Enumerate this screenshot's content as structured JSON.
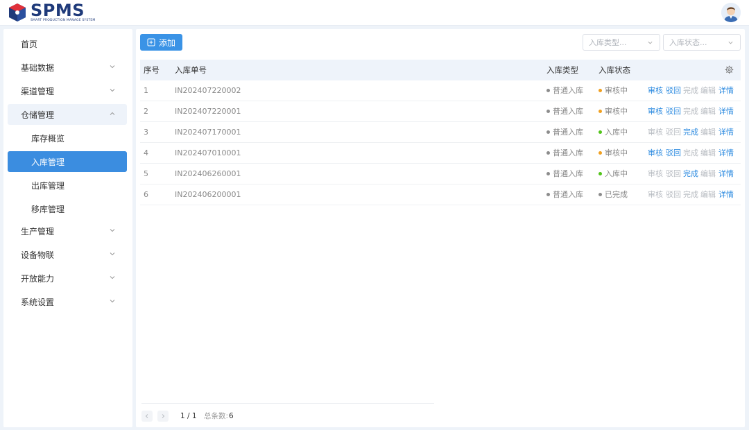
{
  "app": {
    "logo_title": "SPMS",
    "logo_subtitle": "SMART PRODUCTION MANAGE SYSTEM"
  },
  "sidebar": {
    "items": [
      {
        "label": "首页"
      },
      {
        "label": "基础数据"
      },
      {
        "label": "渠道管理"
      },
      {
        "label": "仓储管理"
      },
      {
        "label": "库存概览"
      },
      {
        "label": "入库管理"
      },
      {
        "label": "出库管理"
      },
      {
        "label": "移库管理"
      },
      {
        "label": "生产管理"
      },
      {
        "label": "设备物联"
      },
      {
        "label": "开放能力"
      },
      {
        "label": "系统设置"
      }
    ]
  },
  "toolbar": {
    "add_label": "添加",
    "filter_type_placeholder": "入库类型...",
    "filter_status_placeholder": "入库状态..."
  },
  "table": {
    "headers": {
      "index": "序号",
      "order_no": "入库单号",
      "type": "入库类型",
      "status": "入库状态"
    },
    "actions": {
      "audit": "审核",
      "reject": "驳回",
      "complete": "完成",
      "edit": "编辑",
      "detail": "详情"
    },
    "rows": [
      {
        "index": "1",
        "order_no": "IN202407220002",
        "type": "普通入库",
        "status": "审核中",
        "status_color": "#f0a020"
      },
      {
        "index": "2",
        "order_no": "IN202407220001",
        "type": "普通入库",
        "status": "审核中",
        "status_color": "#f0a020"
      },
      {
        "index": "3",
        "order_no": "IN202407170001",
        "type": "普通入库",
        "status": "入库中",
        "status_color": "#52c41a"
      },
      {
        "index": "4",
        "order_no": "IN202407010001",
        "type": "普通入库",
        "status": "审核中",
        "status_color": "#f0a020"
      },
      {
        "index": "5",
        "order_no": "IN202406260001",
        "type": "普通入库",
        "status": "入库中",
        "status_color": "#52c41a"
      },
      {
        "index": "6",
        "order_no": "IN202406200001",
        "type": "普通入库",
        "status": "已完成",
        "status_color": "#8c8c8c"
      }
    ]
  },
  "pager": {
    "page": "1 / 1",
    "total_label": "总条数:",
    "total": "6"
  },
  "colors": {
    "accent": "#3a93e6",
    "link": "#2f8ce0",
    "disabled": "#b8bcc2",
    "type_dot": "#8c8c8c"
  }
}
